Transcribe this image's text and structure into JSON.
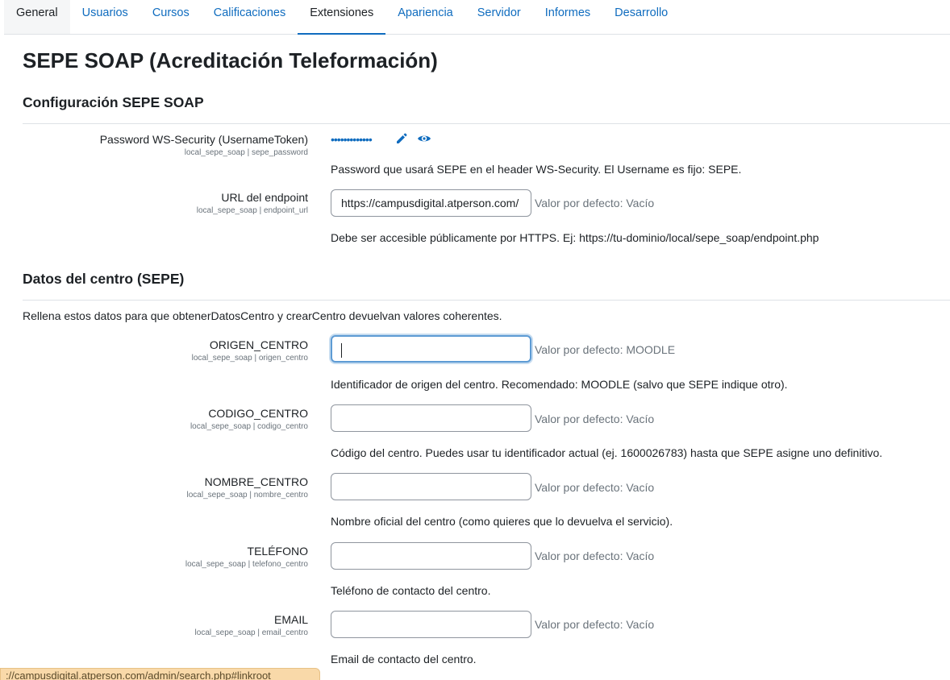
{
  "tabs": [
    "General",
    "Usuarios",
    "Cursos",
    "Calificaciones",
    "Extensiones",
    "Apariencia",
    "Servidor",
    "Informes",
    "Desarrollo"
  ],
  "page_title": "SEPE SOAP (Acreditación Teleformación)",
  "section1": {
    "title": "Configuración SEPE SOAP",
    "password": {
      "label": "Password WS-Security (UsernameToken)",
      "setting": "local_sepe_soap | sepe_password",
      "masked": "•••••••••••••",
      "edit_icon": "pencil-icon",
      "reveal_icon": "eye-icon",
      "description": "Password que usará SEPE en el header WS-Security. El Username es fijo: SEPE."
    },
    "endpoint": {
      "label": "URL del endpoint",
      "setting": "local_sepe_soap | endpoint_url",
      "value": "https://campusdigital.atperson.com/",
      "default": "Valor por defecto: Vacío",
      "description": "Debe ser accesible públicamente por HTTPS. Ej: https://tu-dominio/local/sepe_soap/endpoint.php"
    }
  },
  "section2": {
    "title": "Datos del centro (SEPE)",
    "intro": "Rellena estos datos para que obtenerDatosCentro y crearCentro devuelvan valores coherentes.",
    "origen": {
      "label": "ORIGEN_CENTRO",
      "setting": "local_sepe_soap | origen_centro",
      "value": "",
      "default": "Valor por defecto: MOODLE",
      "description": "Identificador de origen del centro. Recomendado: MOODLE (salvo que SEPE indique otro)."
    },
    "codigo": {
      "label": "CODIGO_CENTRO",
      "setting": "local_sepe_soap | codigo_centro",
      "value": "",
      "default": "Valor por defecto: Vacío",
      "description": "Código del centro. Puedes usar tu identificador actual (ej. 1600026783) hasta que SEPE asigne uno definitivo."
    },
    "nombre": {
      "label": "NOMBRE_CENTRO",
      "setting": "local_sepe_soap | nombre_centro",
      "value": "",
      "default": "Valor por defecto: Vacío",
      "description": "Nombre oficial del centro (como quieres que lo devuelva el servicio)."
    },
    "telefono": {
      "label": "TELÉFONO",
      "setting": "local_sepe_soap | telefono_centro",
      "value": "",
      "default": "Valor por defecto: Vacío",
      "description": "Teléfono de contacto del centro."
    },
    "email": {
      "label": "EMAIL",
      "setting": "local_sepe_soap | email_centro",
      "value": "",
      "default": "Valor por defecto: Vacío",
      "description": "Email de contacto del centro."
    }
  },
  "status_bar": "://campusdigital.atperson.com/admin/search.php#linkroot",
  "colors": {
    "link": "#0f6cbf",
    "text": "#1d2125",
    "muted": "#6a737b",
    "status_bar_bg": "#f9d9a9"
  }
}
